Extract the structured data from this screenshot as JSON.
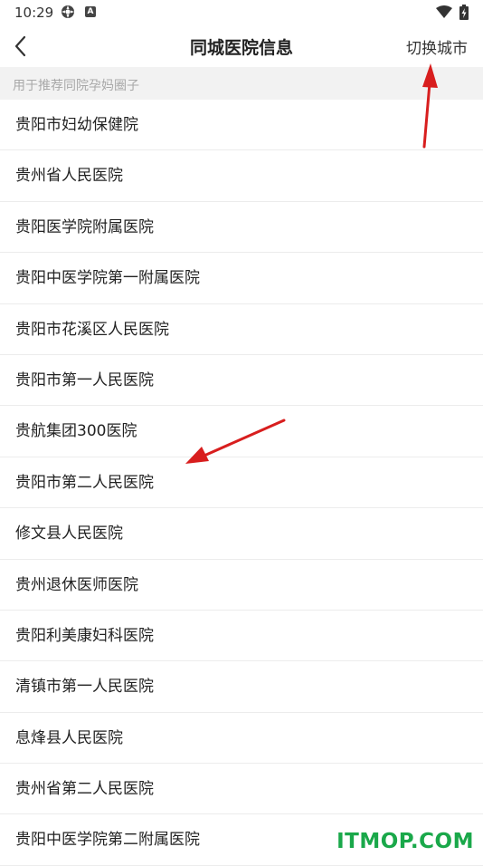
{
  "status_bar": {
    "time": "10:29",
    "icons": [
      "settings-gear-icon",
      "a-notification-icon",
      "wifi-icon",
      "battery-icon"
    ]
  },
  "header": {
    "back_icon": "back-chevron-icon",
    "title": "同城医院信息",
    "switch_city_label": "切换城市"
  },
  "hint": "用于推荐同院孕妈圈子",
  "hospitals": [
    "贵阳市妇幼保健院",
    "贵州省人民医院",
    "贵阳医学院附属医院",
    "贵阳中医学院第一附属医院",
    "贵阳市花溪区人民医院",
    "贵阳市第一人民医院",
    "贵航集团300医院",
    "贵阳市第二人民医院",
    "修文县人民医院",
    "贵州退休医师医院",
    "贵阳利美康妇科医院",
    "清镇市第一人民医院",
    "息烽县人民医院",
    "贵州省第二人民医院",
    "贵阳中医学院第二附属医院"
  ],
  "watermark": "ITMOP.COM",
  "colors": {
    "annotation_arrow": "#d81e1e",
    "watermark": "#1aa84a",
    "hint_background": "#f2f2f2",
    "divider": "#ececec"
  }
}
